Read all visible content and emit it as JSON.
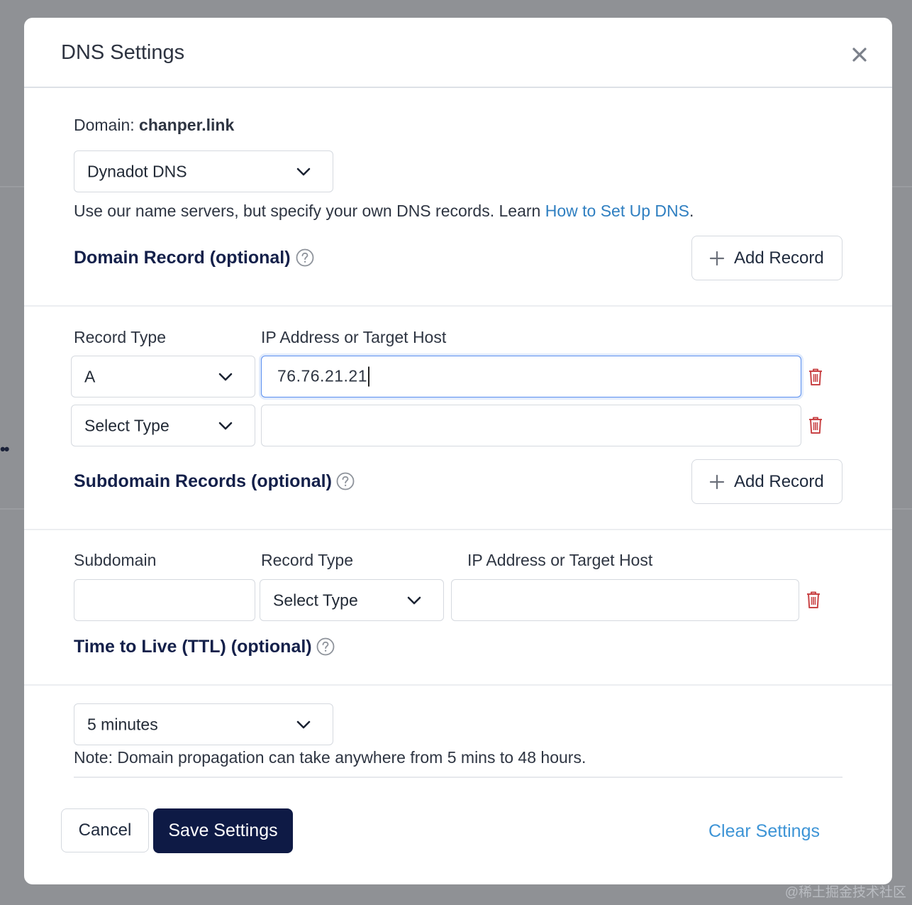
{
  "dialog": {
    "title": "DNS Settings"
  },
  "domain": {
    "label": "Domain:",
    "name": "chanper.link"
  },
  "dns_provider": {
    "selected": "Dynadot DNS"
  },
  "description": {
    "text": "Use our name servers, but specify your own DNS records. Learn ",
    "link": "How to Set Up DNS",
    "suffix": "."
  },
  "domain_record": {
    "title": "Domain Record (optional)",
    "add_button": "Add Record",
    "col_record_type": "Record Type",
    "col_target": "IP Address or Target Host",
    "rows": [
      {
        "type": "A",
        "value": "76.76.21.21"
      },
      {
        "type": "Select Type",
        "value": ""
      }
    ]
  },
  "subdomain_records": {
    "title": "Subdomain Records (optional)",
    "add_button": "Add Record",
    "col_subdomain": "Subdomain",
    "col_record_type": "Record Type",
    "col_target": "IP Address or Target Host",
    "rows": [
      {
        "subdomain": "",
        "type": "Select Type",
        "value": ""
      }
    ]
  },
  "ttl": {
    "title": "Time to Live (TTL) (optional)",
    "selected": "5 minutes",
    "note": "Note: Domain propagation can take anywhere from 5 mins to 48 hours."
  },
  "footer": {
    "cancel": "Cancel",
    "save": "Save Settings",
    "clear": "Clear Settings"
  },
  "watermark": "@稀土掘金技术社区",
  "colors": {
    "primary_button": "#0e1a45",
    "link": "#2f7fc1",
    "delete_icon": "#c94446",
    "focus_border": "#5a8ff0"
  }
}
